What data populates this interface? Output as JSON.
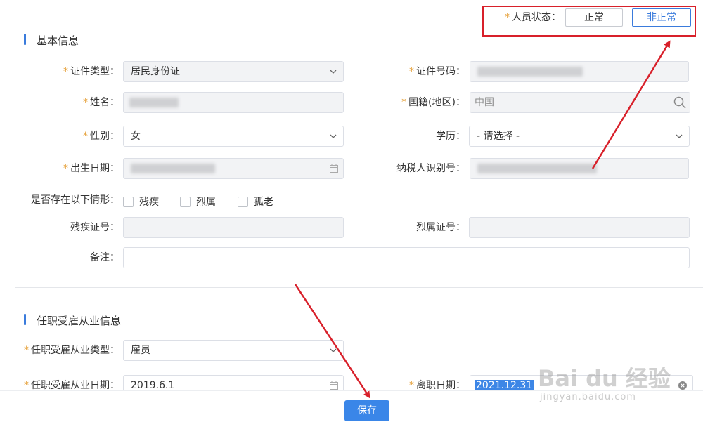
{
  "status": {
    "label": "人员状态：",
    "options": [
      "正常",
      "非正常"
    ],
    "selected": "非正常"
  },
  "sections": {
    "basic": "基本信息",
    "employment": "任职受雇从业信息"
  },
  "fields": {
    "id_type": {
      "label": "证件类型：",
      "value": "居民身份证"
    },
    "id_number": {
      "label": "证件号码："
    },
    "name": {
      "label": "姓名："
    },
    "nationality": {
      "label": "国籍(地区)：",
      "value": "中国"
    },
    "gender": {
      "label": "性别：",
      "value": "女"
    },
    "education": {
      "label": "学历：",
      "value": "- 请选择 -"
    },
    "birth_date": {
      "label": "出生日期："
    },
    "taxpayer_id": {
      "label": "纳税人识别号："
    },
    "situations": {
      "label": "是否存在以下情形：",
      "options": [
        "残疾",
        "烈属",
        "孤老"
      ]
    },
    "disability_no": {
      "label": "残疾证号："
    },
    "martyr_no": {
      "label": "烈属证号："
    },
    "remark": {
      "label": "备注："
    },
    "employment_type": {
      "label": "任职受雇从业类型：",
      "value": "雇员"
    },
    "employment_date": {
      "label": "任职受雇从业日期：",
      "value": "2019.6.1"
    },
    "leave_date": {
      "label": "离职日期：",
      "value": "2021.12.31"
    }
  },
  "actions": {
    "save": "保存"
  },
  "watermark": {
    "brand": "Bai du 经验",
    "url": "jingyan.baidu.com"
  },
  "annotation_color": "#d8202a"
}
